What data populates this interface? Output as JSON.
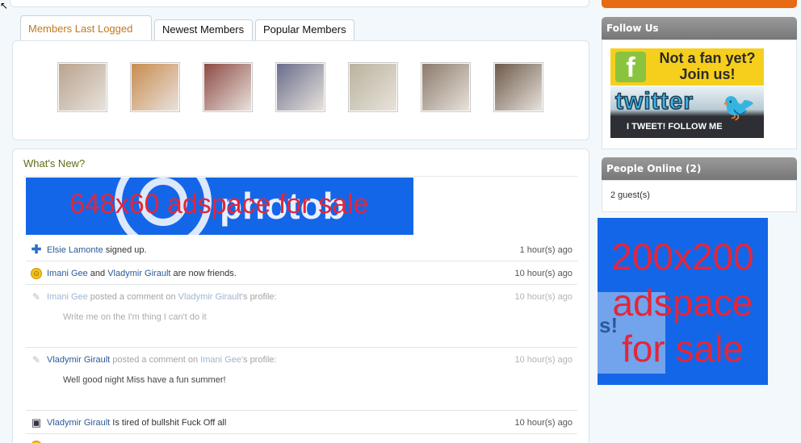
{
  "tabs": [
    {
      "label": "Members Last Logged In",
      "active": true
    },
    {
      "label": "Newest Members",
      "active": false
    },
    {
      "label": "Popular Members",
      "active": false
    }
  ],
  "members": [
    {
      "name": "member-1",
      "color": "#b9a38d"
    },
    {
      "name": "member-2",
      "color": "#c98b4f"
    },
    {
      "name": "member-3",
      "color": "#8e4a45"
    },
    {
      "name": "member-4",
      "color": "#6a6d8c"
    },
    {
      "name": "member-5",
      "color": "#b9b39d"
    },
    {
      "name": "member-6",
      "color": "#8c7a6c"
    },
    {
      "name": "member-7",
      "color": "#6d5a4a"
    }
  ],
  "whats_new": {
    "title": "What's New?",
    "ad_text": "648x60 adspace for sale",
    "watermark": "photob"
  },
  "feed": [
    {
      "icon": "plus-icon",
      "actor": "Elsie Lamonte",
      "text": " signed up.",
      "target": "",
      "tail": "",
      "time": "1 hour(s) ago",
      "body": "",
      "faded": false
    },
    {
      "icon": "smiley-icon",
      "actor": "Imani Gee",
      "text": " and ",
      "target": "Vladymir Girault",
      "tail": " are now friends.",
      "time": "10 hour(s) ago",
      "body": "",
      "faded": false
    },
    {
      "icon": "comment-icon",
      "actor": "Imani Gee",
      "text": " posted a comment on ",
      "target": "Vladymir Girault",
      "tail": "'s profile:",
      "time": "10 hour(s) ago",
      "body": "Write me on the I'm thing I can't do it",
      "faded": true
    },
    {
      "icon": "comment-icon",
      "actor": "Vladymir Girault",
      "text": " posted a comment on ",
      "target": "Imani Gee",
      "tail": "'s profile:",
      "time": "10 hour(s) ago",
      "body": "Well good night Miss have a fun summer!",
      "faded": true
    },
    {
      "icon": "monitor-icon",
      "actor": "Vladymir Girault",
      "text": " Is tired of bullshit Fuck Off all",
      "target": "",
      "tail": "",
      "time": "10 hour(s) ago",
      "body": "",
      "faded": false
    }
  ],
  "sidebar": {
    "follow_title": "Follow Us",
    "facebook_text": "Not a fan yet? Join us!",
    "facebook_letter": "f",
    "twitter_logo": "twitter",
    "twitter_caption": "I TWEET! FOLLOW ME",
    "online_title": "People Online (2)",
    "online_text": "2 guest(s)",
    "ad_text": "200x200 adspace for sale",
    "ad_panel_text": "s!"
  }
}
